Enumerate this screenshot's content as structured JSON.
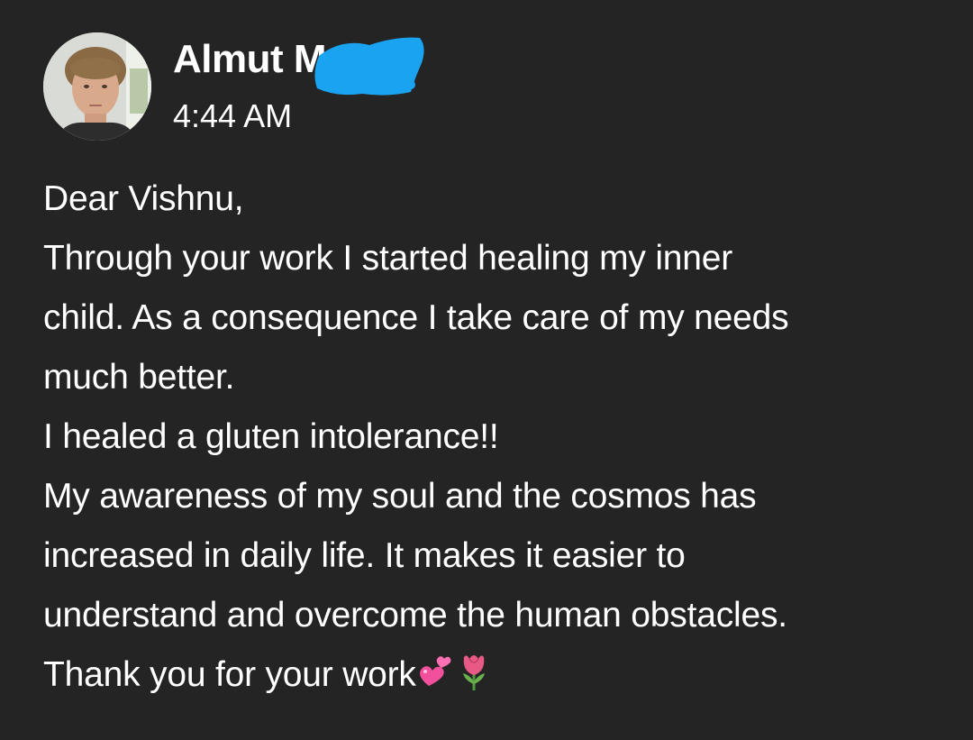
{
  "post": {
    "author": {
      "name": "Almut M",
      "avatar_icon": "profile-photo",
      "name_redacted": true,
      "redaction_color": "#1aa3f0"
    },
    "timestamp": "4:44 AM",
    "message": {
      "lines": [
        "Dear Vishnu,",
        "Through your work I started healing my inner",
        "child. As a consequence I take care of my needs",
        "much better.",
        "I healed a gluten intolerance!!",
        "My awareness of my soul and the cosmos has",
        "increased in daily life. It makes it easier to",
        "understand and overcome the human obstacles.",
        "Thank you for your work"
      ],
      "trailing_emojis": [
        "two-hearts-icon",
        "tulip-icon"
      ]
    }
  },
  "colors": {
    "background": "#242424",
    "text": "#ffffff"
  }
}
